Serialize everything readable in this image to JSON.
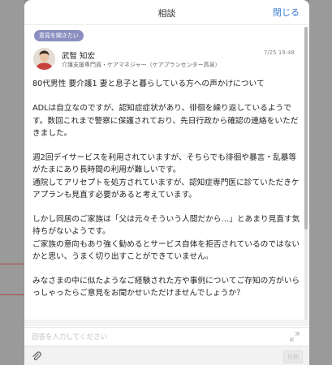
{
  "modal": {
    "title": "相談",
    "close_label": "閉じる"
  },
  "post": {
    "tag": "意見を聞きたい",
    "author_name": "武智 知宏",
    "author_role": "介護支援専門員・ケアマネジャー（ケアプランセンター高泉）",
    "time": "7/25 19:48",
    "paragraphs": [
      "80代男性 要介護1 妻と息子と暮らしている方への声かけについて",
      "",
      "ADLは自立なのですが、認知症症状があり、徘徊を繰り返しているようです。数回これまで警察に保護されており、先日行政から確認の連絡をいただきました。",
      "",
      "週2回デイサービスを利用されていますが、そちらでも徘徊や暴言・乱暴等がたまにあり長時間の利用が難しいです。",
      "通院してアリセプトを処方されていますが、認知症専門医に診ていただきケアプランも見直す必要があると考えています。",
      "",
      "しかし同居のご家族は「父は元々そういう人間だから…」とあまり見直す気持ちがないようです。",
      "ご家族の意向もあり強く勧めるとサービス自体を拒否されているのではないかと思い、うまく切り出すことができていません。",
      "",
      "みなさまの中に似たようなご経験された方や事例についてご存知の方がいらっしゃったらご意見をお聞かせいただけませんでしょうか？"
    ]
  },
  "composer": {
    "placeholder": "回答を入力してください",
    "send_label": "投稿"
  },
  "icons": {
    "expand": "expand-icon",
    "attach": "paperclip-icon"
  },
  "colors": {
    "accent": "#3a7bd5",
    "tag_bg": "#8a8fc0"
  }
}
